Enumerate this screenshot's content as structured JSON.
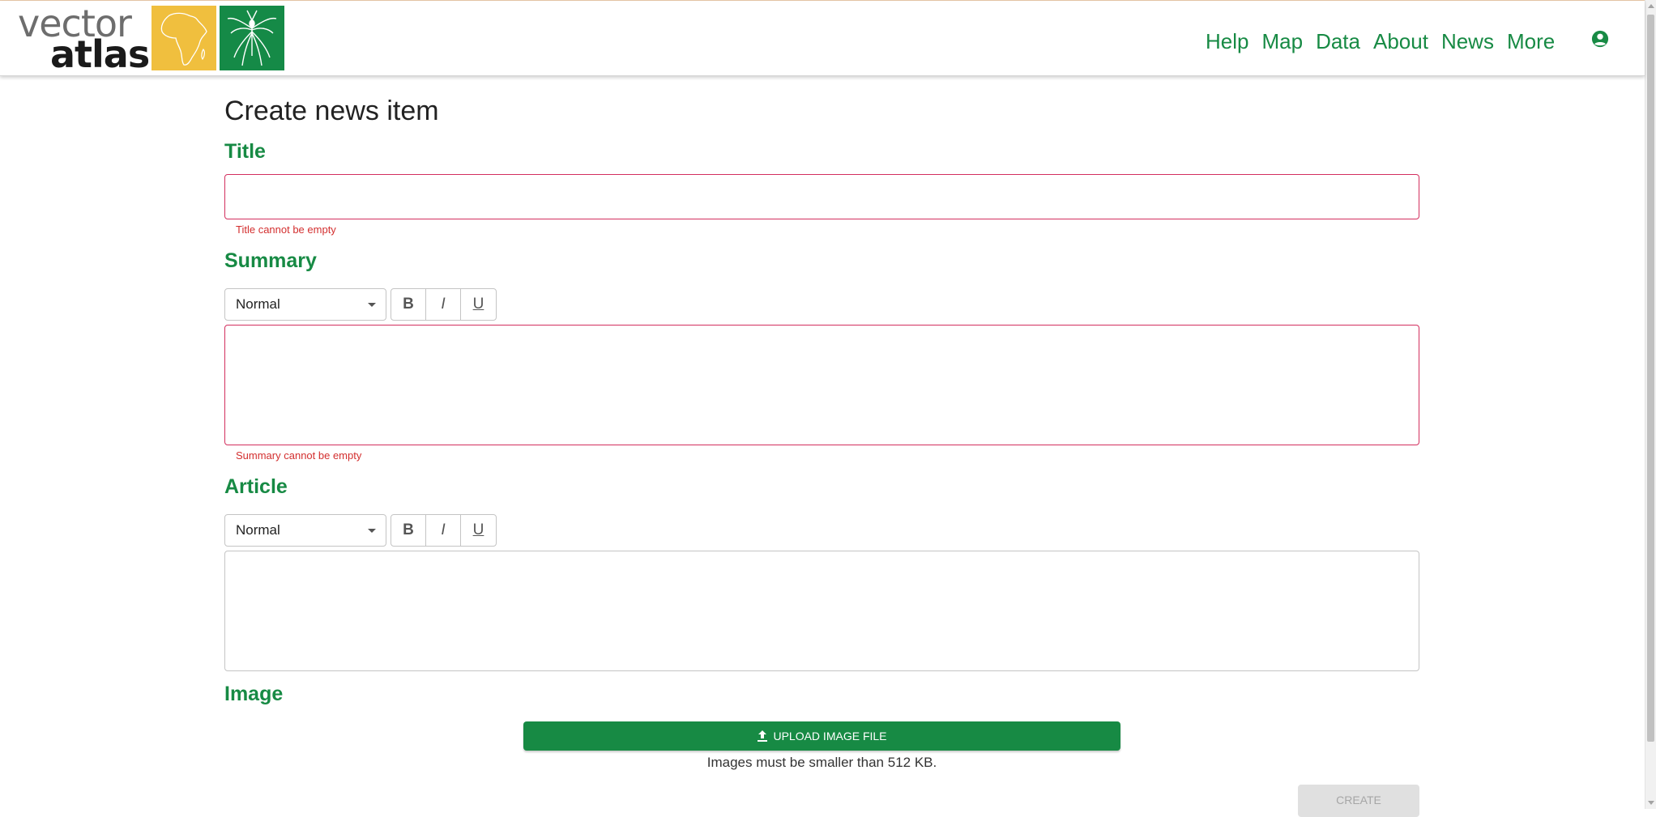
{
  "header": {
    "logo_line1": "vector",
    "logo_line2": "atlas",
    "nav": [
      "Help",
      "Map",
      "Data",
      "About",
      "News",
      "More"
    ],
    "account_icon": "account-circle-icon"
  },
  "main": {
    "page_title": "Create news item",
    "title_section": {
      "label": "Title",
      "value": "",
      "error": "Title cannot be empty"
    },
    "summary_section": {
      "label": "Summary",
      "format_select": "Normal",
      "value": "",
      "error": "Summary cannot be empty"
    },
    "article_section": {
      "label": "Article",
      "format_select": "Normal",
      "value": ""
    },
    "format_buttons": [
      "B",
      "I",
      "U"
    ],
    "image_section": {
      "label": "Image",
      "upload_label": "UPLOAD IMAGE FILE",
      "note": "Images must be smaller than 512 KB."
    },
    "create_label": "CREATE"
  },
  "colors": {
    "brand_green": "#178a44",
    "logo_yellow": "#f0bf3e",
    "error_red": "#d32f2f",
    "disabled_bg": "#e0e0e0"
  }
}
